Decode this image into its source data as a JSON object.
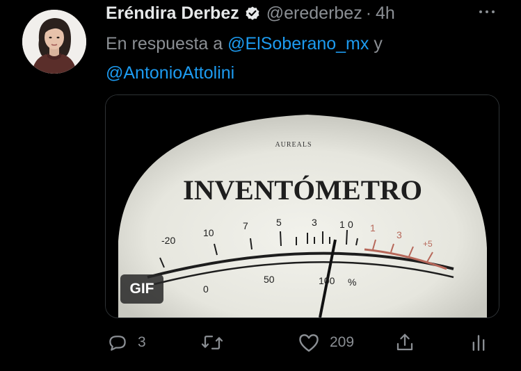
{
  "tweet": {
    "display_name": "Eréndira Derbez",
    "handle": "@erederbez",
    "separator": "·",
    "time": "4h",
    "reply_prefix": "En respuesta a",
    "mention_1": "@ElSoberano_mx",
    "reply_connector": "y",
    "mention_2": "@AntonioAttolini"
  },
  "media": {
    "badge": "GIF",
    "meter": {
      "brand": "AUREALS",
      "title": "INVENTÓMETRO",
      "scale_top": [
        "-20",
        "10",
        "7",
        "5",
        "3",
        "1",
        "0",
        "1",
        "3",
        "+5"
      ],
      "scale_bottom": [
        "0",
        "50",
        "100",
        "%"
      ]
    }
  },
  "actions": {
    "reply_count": "3",
    "retweet_count": "",
    "like_count": "209"
  },
  "colors": {
    "background": "#000000",
    "text_primary": "#e7e9ea",
    "text_secondary": "#8b8f94",
    "link": "#1d9bf0",
    "border": "#2f3336"
  },
  "icons": [
    "verified-badge-icon",
    "more-options-icon",
    "reply-icon",
    "retweet-icon",
    "like-icon",
    "share-icon",
    "analytics-icon"
  ]
}
